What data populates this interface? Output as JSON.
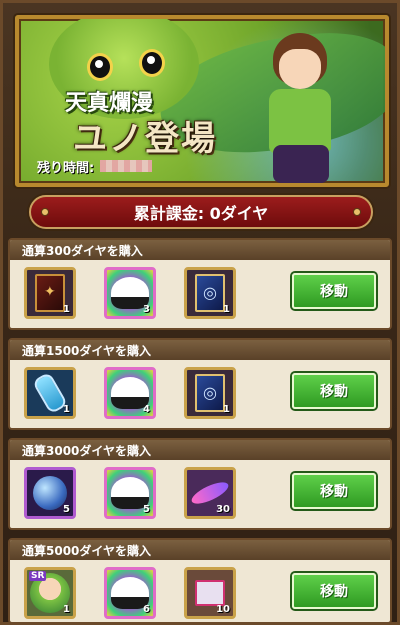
{
  "banner": {
    "title_line1": "天真爛漫",
    "title_line2": "ユノ登場",
    "remaining_label": "残り時間:"
  },
  "total": {
    "label": "累計課金: 0ダイヤ"
  },
  "sections": [
    {
      "title": "通算300ダイヤを購入",
      "items": [
        {
          "icon": "red-card-icon",
          "count": "1"
        },
        {
          "icon": "onigiri-icon",
          "count": "3"
        },
        {
          "icon": "blue-card-icon",
          "count": "1"
        }
      ],
      "button": "移動"
    },
    {
      "title": "通算1500ダイヤを購入",
      "items": [
        {
          "icon": "potion-icon",
          "count": "1"
        },
        {
          "icon": "onigiri-icon",
          "count": "4"
        },
        {
          "icon": "blue-card-icon",
          "count": "1"
        }
      ],
      "button": "移動"
    },
    {
      "title": "通算3000ダイヤを購入",
      "items": [
        {
          "icon": "orb-icon",
          "count": "5"
        },
        {
          "icon": "onigiri-icon",
          "count": "5"
        },
        {
          "icon": "feather-icon",
          "count": "30"
        }
      ],
      "button": "移動"
    },
    {
      "title": "通算5000ダイヤを購入",
      "items": [
        {
          "icon": "character-icon",
          "count": "1",
          "badge": "SR"
        },
        {
          "icon": "onigiri-icon",
          "count": "6"
        },
        {
          "icon": "gift-box-icon",
          "count": "10"
        }
      ],
      "button": "移動"
    }
  ],
  "colors": {
    "button_green": "#3fb52e",
    "total_bar_red": "#8a1414",
    "frame_gold": "#b8892e",
    "section_bg": "#efe7d4"
  }
}
